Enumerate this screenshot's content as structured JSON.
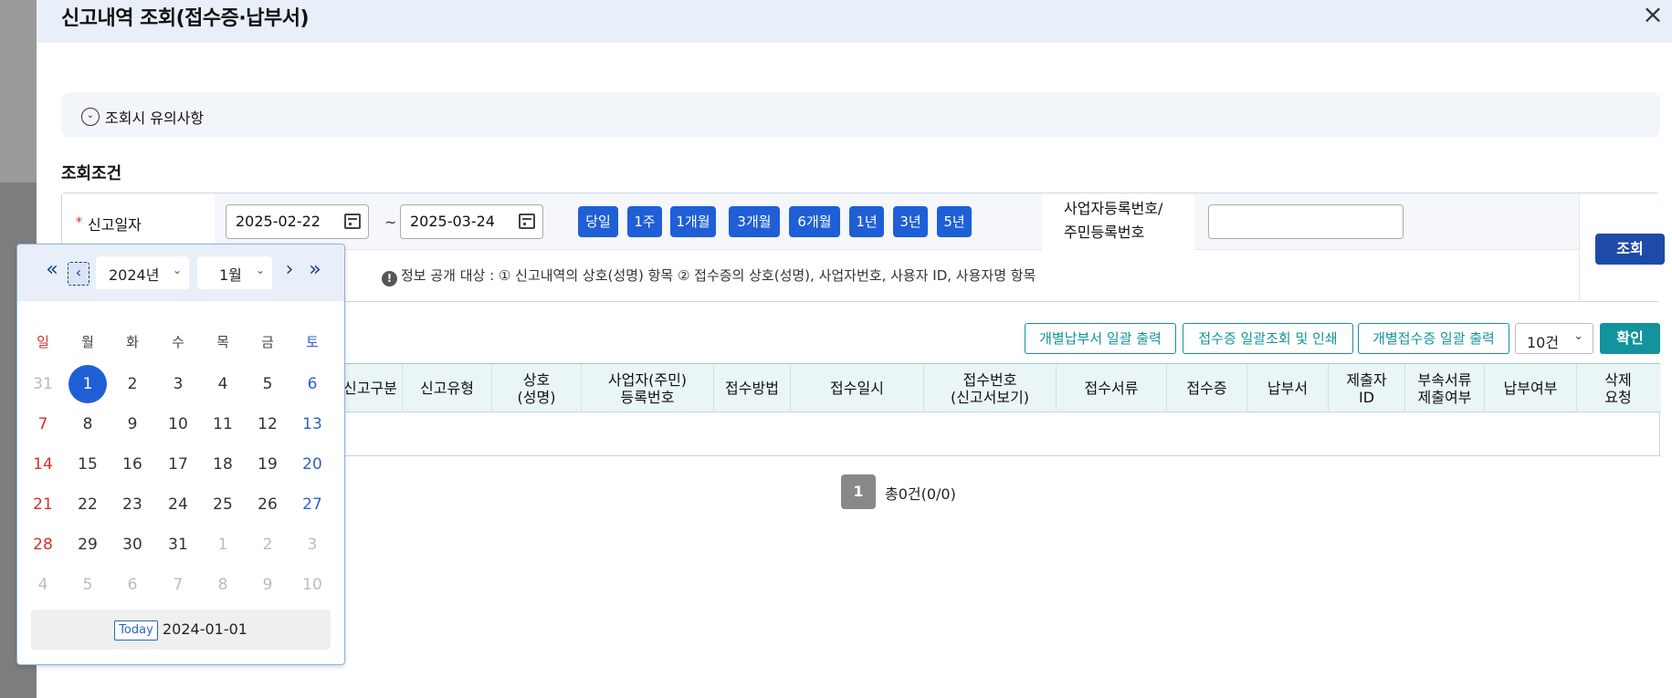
{
  "modal": {
    "title": "신고내역 조회(접수증·납부서)",
    "close_icon": "×"
  },
  "notice": {
    "label": "조회시 유의사항",
    "icon": "⌄"
  },
  "search": {
    "section_title": "조회조건",
    "date_label": "신고일자",
    "required_mark": "*",
    "start_date": "2025-02-22",
    "end_date": "2025-03-24",
    "tilde": "~",
    "ranges": [
      "당일",
      "1주",
      "1개월",
      "3개월",
      "6개월",
      "1년",
      "3년",
      "5년"
    ],
    "biz_label_line1": "사업자등록번호/",
    "biz_label_line2": "주민등록번호",
    "biz_value": "",
    "search_button": "조회",
    "info_icon": "!",
    "info_text": "정보 공개 대상 : ① 신고내역의 상호(성명) 항목 ② 접수증의 상호(성명), 사업자번호, 사용자 ID, 사용자명 항목"
  },
  "actions": {
    "bulk_payment_print": "개별납부서 일괄 출력",
    "receipt_bulk_print": "접수증 일괄조회 및 인쇄",
    "bulk_receipt_print": "개별접수증 일괄 출력",
    "page_size": "10건",
    "page_size_caret": "⌄",
    "confirm": "확인"
  },
  "table": {
    "headers": [
      "신고구분",
      "신고유형",
      "상호\n(성명)",
      "사업자(주민)\n등록번호",
      "접수방법",
      "접수일시",
      "접수번호\n(신고서보기)",
      "접수서류",
      "접수증",
      "납부서",
      "제출자\nID",
      "부속서류\n제출여부",
      "납부여부",
      "삭제\n요청"
    ]
  },
  "pagination": {
    "current_page": "1",
    "total": "총0건(0/0)"
  },
  "datepicker": {
    "first_nav": "«",
    "prev_nav": "‹",
    "next_nav": "›",
    "last_nav": "»",
    "year": "2024년",
    "month": "1월",
    "caret": "⌄",
    "weekdays": [
      "일",
      "월",
      "화",
      "수",
      "목",
      "금",
      "토"
    ],
    "weeks": [
      [
        "31",
        "1",
        "2",
        "3",
        "4",
        "5",
        "6"
      ],
      [
        "7",
        "8",
        "9",
        "10",
        "11",
        "12",
        "13"
      ],
      [
        "14",
        "15",
        "16",
        "17",
        "18",
        "19",
        "20"
      ],
      [
        "21",
        "22",
        "23",
        "24",
        "25",
        "26",
        "27"
      ],
      [
        "28",
        "29",
        "30",
        "31",
        "1",
        "2",
        "3"
      ],
      [
        "4",
        "5",
        "6",
        "7",
        "8",
        "9",
        "10"
      ]
    ],
    "today_button": "Today",
    "selected_value": "2024-01-01"
  }
}
